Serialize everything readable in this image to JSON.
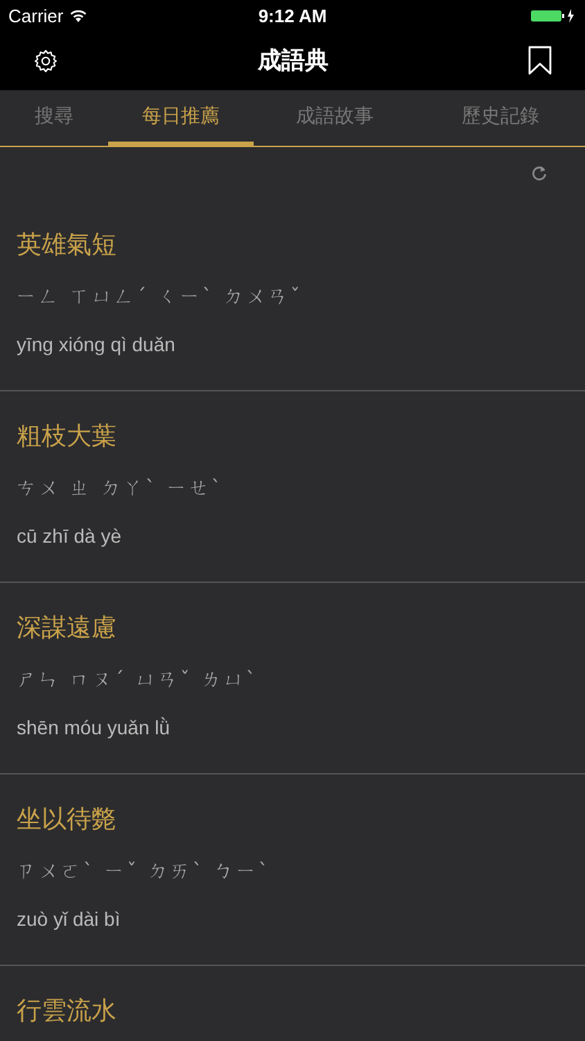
{
  "status_bar": {
    "carrier": "Carrier",
    "time": "9:12 AM"
  },
  "nav_bar": {
    "title": "成語典"
  },
  "tabs": [
    {
      "label": "搜尋",
      "selected": false
    },
    {
      "label": "每日推薦",
      "selected": true
    },
    {
      "label": "成語故事",
      "selected": false
    },
    {
      "label": "歷史記錄",
      "selected": false
    }
  ],
  "idioms": [
    {
      "title": "英雄氣短",
      "zhuyin": "ㄧㄥ ㄒㄩㄥˊ ㄑㄧˋ ㄉㄨㄢˇ",
      "pinyin": "yīng xióng qì duǎn"
    },
    {
      "title": "粗枝大葉",
      "zhuyin": "ㄘㄨ ㄓ ㄉㄚˋ ㄧㄝˋ",
      "pinyin": "cū zhī dà yè"
    },
    {
      "title": "深謀遠慮",
      "zhuyin": "ㄕㄣ ㄇㄡˊ ㄩㄢˇ ㄌㄩˋ",
      "pinyin": "shēn móu yuǎn lǜ"
    },
    {
      "title": "坐以待斃",
      "zhuyin": "ㄗㄨㄛˋ ㄧˇ ㄉㄞˋ ㄅㄧˋ",
      "pinyin": "zuò yǐ dài bì"
    },
    {
      "title": "行雲流水"
    }
  ]
}
